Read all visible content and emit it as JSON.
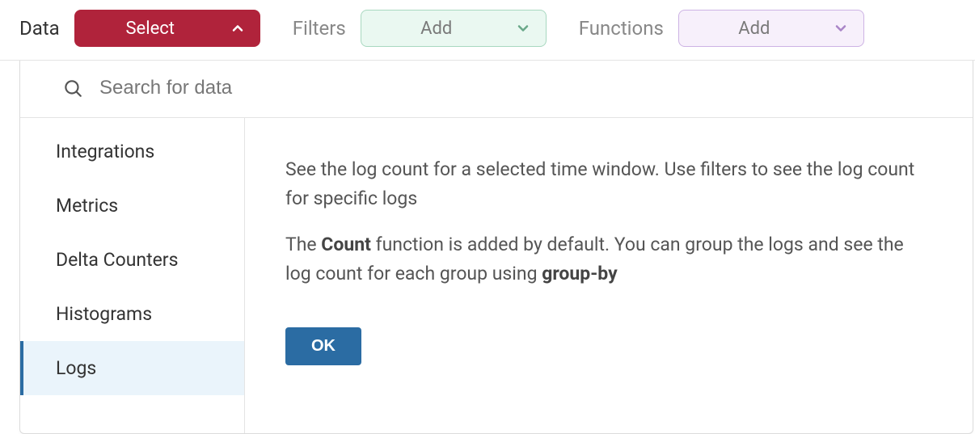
{
  "toolbar": {
    "data_label": "Data",
    "select_label": "Select",
    "filters_label": "Filters",
    "filters_button": "Add",
    "functions_label": "Functions",
    "functions_button": "Add"
  },
  "search": {
    "placeholder": "Search for data"
  },
  "sidebar": {
    "items": [
      {
        "label": "Integrations"
      },
      {
        "label": "Metrics"
      },
      {
        "label": "Delta Counters"
      },
      {
        "label": "Histograms"
      },
      {
        "label": "Logs"
      }
    ],
    "selected_index": 4
  },
  "content": {
    "paragraph1": "See the log count for a selected time window. Use filters to see the log count for specific logs",
    "paragraph2_prefix": "The ",
    "paragraph2_bold1": "Count",
    "paragraph2_mid": " function is added by default. You can group the logs and see the log count for each group using ",
    "paragraph2_bold2": "group-by",
    "ok_label": "OK"
  }
}
